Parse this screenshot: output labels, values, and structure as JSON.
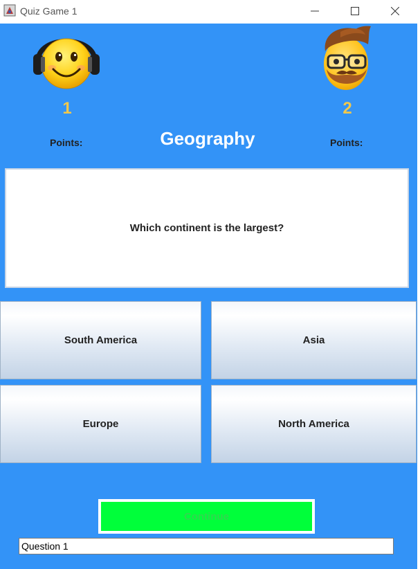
{
  "window": {
    "title": "Quiz Game 1",
    "minimize_icon": "minimize-icon",
    "maximize_icon": "maximize-icon",
    "close_icon": "close-icon"
  },
  "players": [
    {
      "avatar_icon": "headphones-smiley-icon",
      "score": "1",
      "points_label": "Points:"
    },
    {
      "avatar_icon": "hipster-emoji-icon",
      "score": "2",
      "points_label": "Points:"
    }
  ],
  "category": "Geography",
  "question": "Which continent is the largest?",
  "answers": [
    "South America",
    "Asia",
    "Europe",
    "North America"
  ],
  "continue_label": "Continue",
  "question_field_value": "Question 1",
  "colors": {
    "background": "#3393f7",
    "score": "#f2c84b",
    "continue": "#00ff3a"
  }
}
